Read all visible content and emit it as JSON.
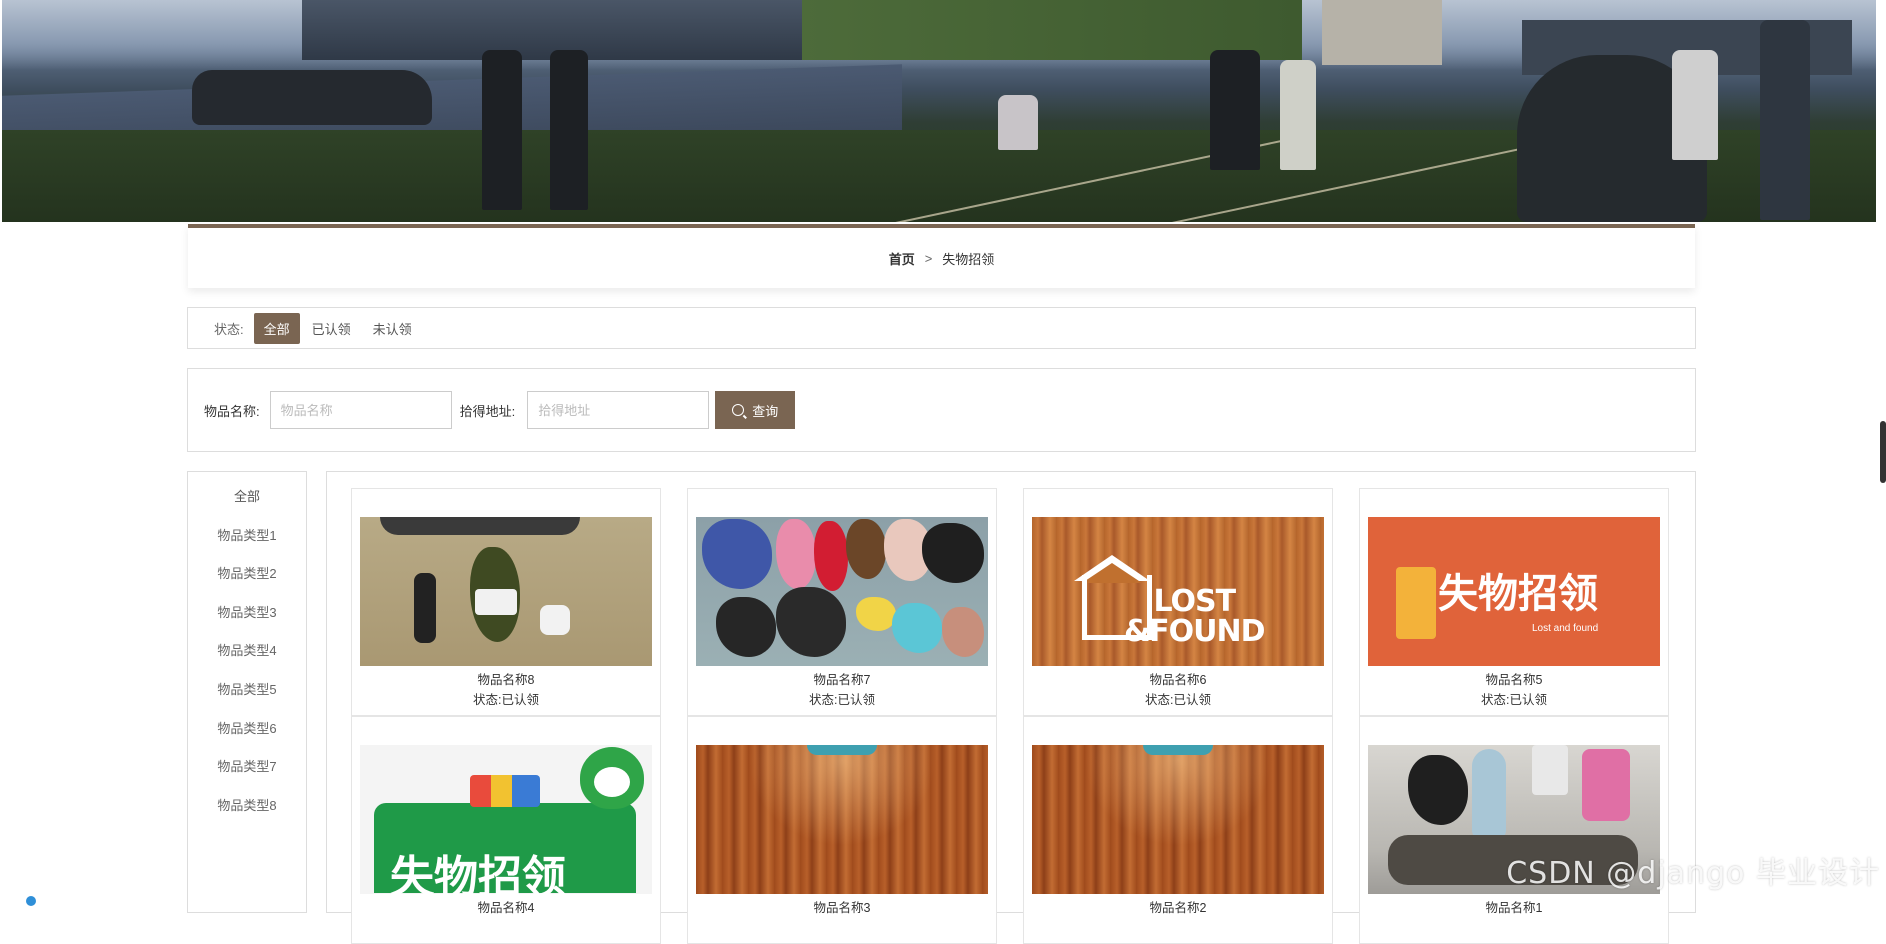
{
  "breadcrumb": {
    "home": "首页",
    "separator": ">",
    "current": "失物招领"
  },
  "status_filter": {
    "label": "状态:",
    "options": [
      "全部",
      "已认领",
      "未认领"
    ],
    "active_index": 0
  },
  "search": {
    "name_label": "物品名称:",
    "name_placeholder": "物品名称",
    "address_label": "拾得地址:",
    "address_placeholder": "拾得地址",
    "button_label": "查询",
    "button_icon": "search-icon"
  },
  "categories": [
    "全部",
    "物品类型1",
    "物品类型2",
    "物品类型3",
    "物品类型4",
    "物品类型5",
    "物品类型6",
    "物品类型7",
    "物品类型8"
  ],
  "items": [
    {
      "name": "物品名称8",
      "status": "状态:已认领"
    },
    {
      "name": "物品名称7",
      "status": "状态:已认领"
    },
    {
      "name": "物品名称6",
      "status": "状态:已认领"
    },
    {
      "name": "物品名称5",
      "status": "状态:已认领"
    },
    {
      "name": "物品名称4",
      "status": ""
    },
    {
      "name": "物品名称3",
      "status": ""
    },
    {
      "name": "物品名称2",
      "status": ""
    },
    {
      "name": "物品名称1",
      "status": ""
    }
  ],
  "thumb_text": {
    "lost_found_en": "LOST\n&FOUND",
    "lost_found_zh": "失物招领",
    "lost_found_sub": "Lost and found",
    "lost_found_zh_green": "失物招领"
  },
  "watermark": "CSDN @django 毕业设计",
  "colors": {
    "accent": "#7a6552",
    "border": "#dddddd",
    "orange": "#e0633a",
    "green": "#1f9a48"
  }
}
